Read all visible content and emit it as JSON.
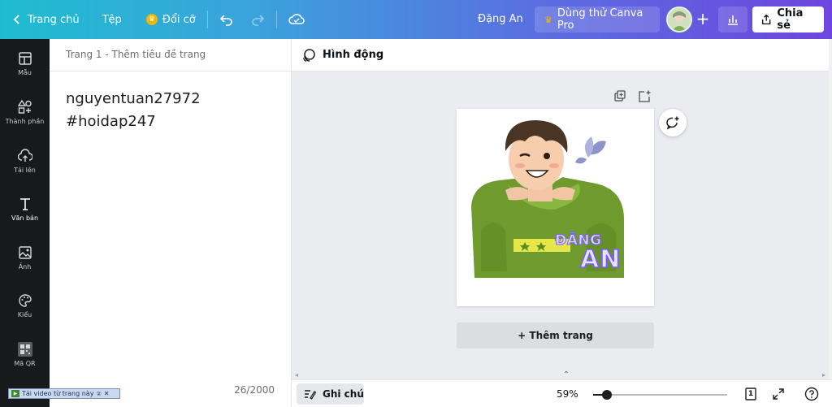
{
  "topbar": {
    "home": "Trang chủ",
    "file": "Tệp",
    "resize": "Đổi cỡ",
    "user_name": "Đặng An",
    "try_pro": "Dùng thử Canva Pro",
    "share": "Chia sẻ"
  },
  "sidebar": {
    "items": [
      {
        "label": "Mẫu",
        "icon": "template-icon"
      },
      {
        "label": "Thành phần",
        "icon": "elements-icon"
      },
      {
        "label": "Tải lên",
        "icon": "upload-icon"
      },
      {
        "label": "Văn bản",
        "icon": "text-icon"
      },
      {
        "label": "Ảnh",
        "icon": "photo-icon"
      },
      {
        "label": "Kiểu",
        "icon": "palette-icon"
      },
      {
        "label": "Mã QR",
        "icon": "qr-icon"
      }
    ]
  },
  "notes": {
    "header": "Trang 1 - Thêm tiêu đề trang",
    "lines": [
      "nguyentuan27972",
      "#hoidap247"
    ],
    "char_count": "26/2000"
  },
  "toolbar": {
    "animate": "Hình động"
  },
  "canvas": {
    "sticker_text_top": "ĐĂNG",
    "sticker_text_bottom": "AN",
    "add_page": "+ Thêm trang"
  },
  "bottombar": {
    "notes": "Ghi chú",
    "zoom": "59%",
    "zoom_fraction": 0.1,
    "page_number": "1"
  },
  "overlay": {
    "video_download": "Tải video từ trang này"
  },
  "colors": {
    "sidebar_bg": "#18191b",
    "canvas_bg": "#ebecf0",
    "hoodie": "#6f9a2e"
  }
}
